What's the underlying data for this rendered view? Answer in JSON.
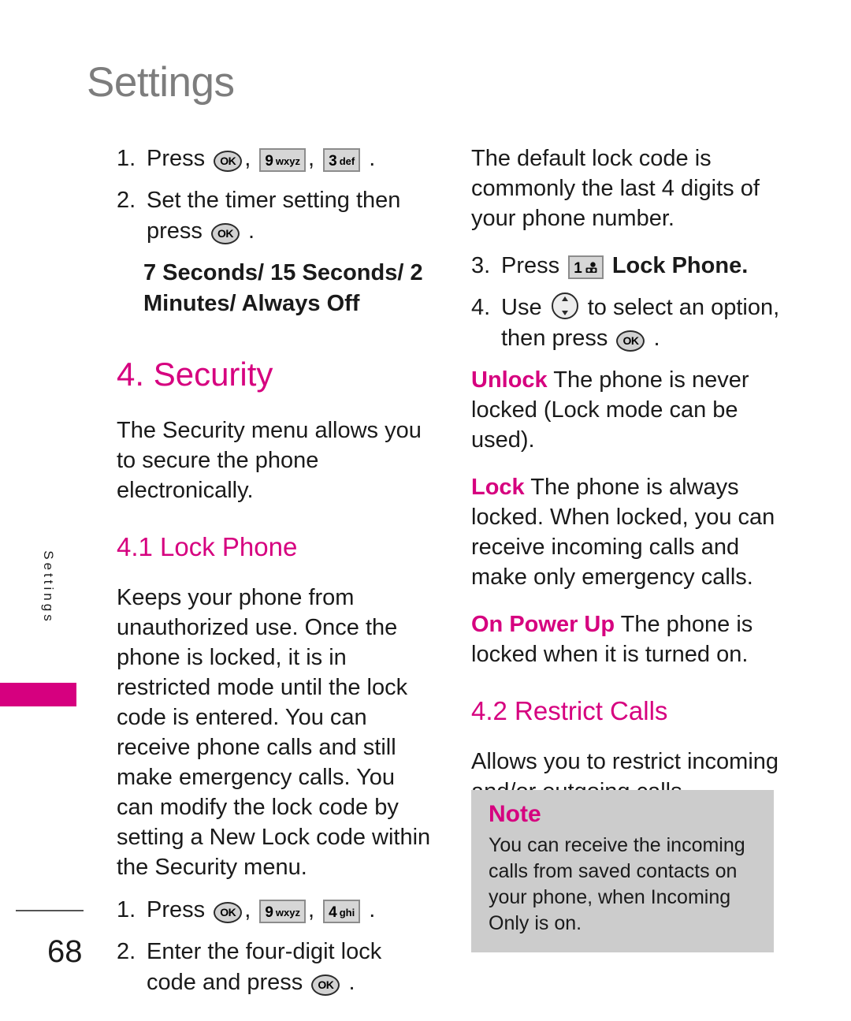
{
  "page": {
    "header": "Settings",
    "side_tab_label": "Settings",
    "page_number": "68"
  },
  "keys": {
    "ok": "OK",
    "nine": {
      "digit": "9",
      "letters": "wxyz"
    },
    "three": {
      "digit": "3",
      "letters": "def"
    },
    "four": {
      "digit": "4",
      "letters": "ghi"
    },
    "one": {
      "digit": "1",
      "letters": "voicemail-icon"
    },
    "nav": "navigation-up-down-key"
  },
  "left_column": {
    "step1": {
      "number": "1.",
      "press_label": "Press",
      "comma1": ",",
      "comma2": ",",
      "period": "."
    },
    "step2": {
      "number": "2.",
      "text_a": "Set the timer setting then press",
      "period": "."
    },
    "timer_options": "7 Seconds/ 15 Seconds/ 2 Minutes/ Always Off",
    "heading_security": "4. Security",
    "security_intro": "The Security menu allows you to secure the phone electronically.",
    "heading_lock_phone": "4.1 Lock Phone",
    "lock_phone_body": "Keeps your phone from unauthorized use. Once the phone is locked, it is in restricted mode until the lock code is entered. You can receive phone calls and still make emergency calls. You can modify the lock code by setting a New Lock code within the Security menu.",
    "step1b": {
      "number": "1.",
      "press_label": "Press",
      "comma1": ",",
      "comma2": ",",
      "period": "."
    },
    "step2b": {
      "number": "2.",
      "text_a": "Enter the four-digit lock code and press",
      "period": "."
    }
  },
  "right_column": {
    "default_code_note": "The default lock code is commonly the last 4 digits of your phone number.",
    "step3": {
      "number": "3.",
      "press_label": "Press",
      "target": "Lock Phone",
      "period": "."
    },
    "step4": {
      "number": "4.",
      "use_label": "Use",
      "text_a": "to select an option, then press",
      "period": "."
    },
    "options": [
      {
        "term": "Unlock",
        "desc": "The phone is never locked (Lock mode can be used)."
      },
      {
        "term": "Lock",
        "desc": "The phone is always locked. When locked, you can receive incoming calls and make only emergency calls."
      },
      {
        "term": "On Power Up",
        "desc": "The phone is locked when it is turned on."
      }
    ],
    "heading_restrict_calls": "4.2 Restrict Calls",
    "restrict_calls_body": "Allows you to restrict incoming and/or outgoing calls.",
    "note": {
      "title": "Note",
      "text": "You can receive the incoming calls from saved contacts on your phone, when Incoming Only is on."
    }
  },
  "colors": {
    "accent_magenta": "#d6007f",
    "header_gray": "#7d7d7d",
    "note_bg": "#cccccc",
    "key_fill": "#d6d6d6"
  }
}
